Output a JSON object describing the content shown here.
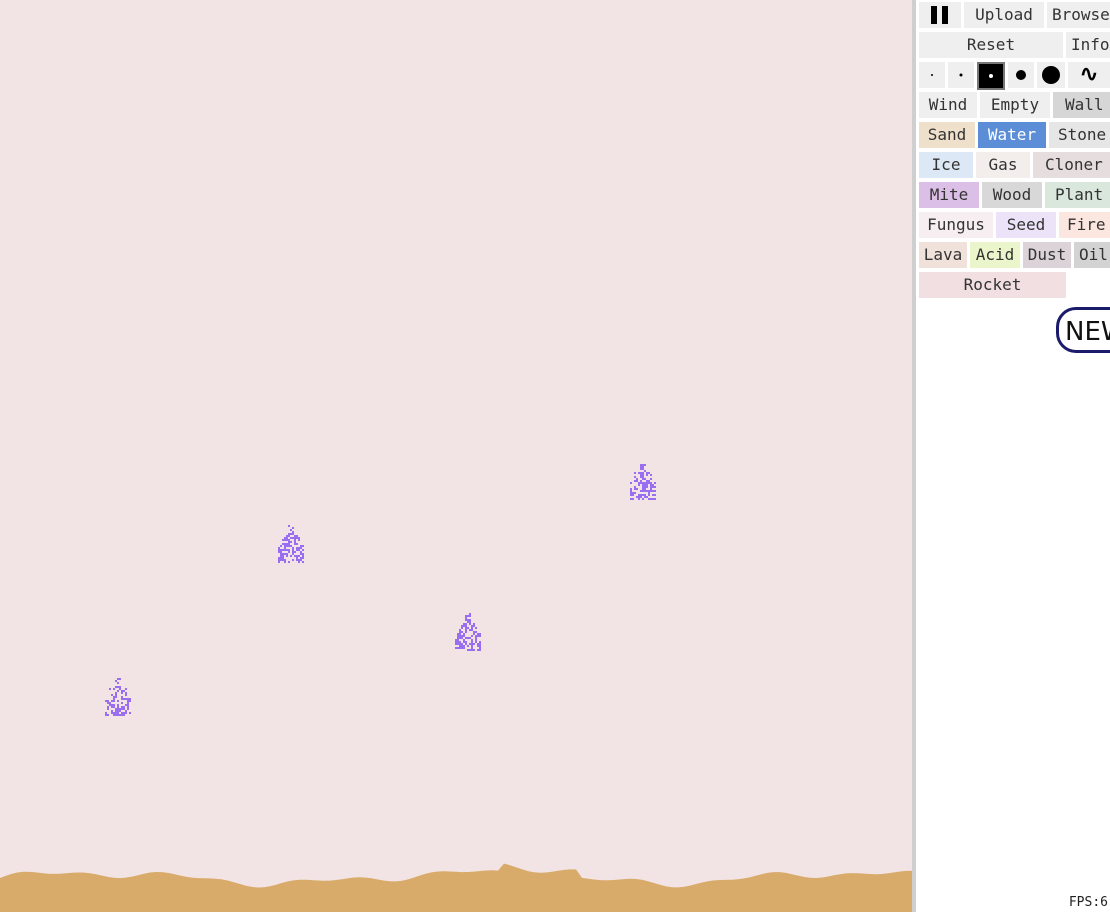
{
  "toolbar": {
    "pause_icon": "pause-icon",
    "upload_label": "Upload",
    "browse_label": "Browse",
    "reset_label": "Reset",
    "info_label": "Info"
  },
  "brush_sizes": {
    "options": [
      "tiny",
      "small",
      "medium",
      "large",
      "xlarge",
      "wave"
    ],
    "selected": "medium",
    "wave_glyph": "∿"
  },
  "elements": {
    "selected": "Water",
    "wind": "Wind",
    "empty": "Empty",
    "wall": "Wall",
    "sand": "Sand",
    "water": "Water",
    "stone": "Stone",
    "ice": "Ice",
    "gas": "Gas",
    "cloner": "Cloner",
    "mite": "Mite",
    "wood": "Wood",
    "plant": "Plant",
    "fungus": "Fungus",
    "seed": "Seed",
    "fire": "Fire",
    "lava": "Lava",
    "acid": "Acid",
    "dust": "Dust",
    "oil": "Oil",
    "rocket": "Rocket"
  },
  "colors": {
    "canvas_bg": "#f2e4e5",
    "sand": "#d9ab6a",
    "particles": "#9a6ef0",
    "selected_button": "#5b8ed6"
  },
  "badge_text": "NEW",
  "fps_text": "FPS:6"
}
